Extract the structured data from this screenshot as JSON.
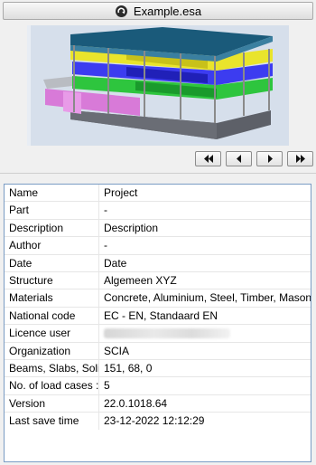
{
  "header": {
    "file_name": "Example.esa"
  },
  "preview": {
    "icon": "building-3d-model-image"
  },
  "navigation": {
    "first": "first-icon",
    "previous": "previous-icon",
    "next": "next-icon",
    "last": "last-icon"
  },
  "properties": {
    "rows": [
      {
        "name": "Name",
        "value": "Project"
      },
      {
        "name": "Part",
        "value": "-"
      },
      {
        "name": "Description",
        "value": "Description"
      },
      {
        "name": "Author",
        "value": "-"
      },
      {
        "name": "Date",
        "value": "Date"
      },
      {
        "name": "Structure",
        "value": "Algemeen XYZ"
      },
      {
        "name": "Materials",
        "value": "Concrete, Aluminium, Steel, Timber, Masonry, F"
      },
      {
        "name": "National code",
        "value": "EC - EN, Standaard EN"
      },
      {
        "name": "Licence user",
        "value": ""
      },
      {
        "name": "Organization",
        "value": "SCIA"
      },
      {
        "name": "Beams, Slabs, Solids",
        "value": "151, 68, 0"
      },
      {
        "name": "No. of load cases :",
        "value": "5"
      },
      {
        "name": "Version",
        "value": "22.0.1018.64"
      },
      {
        "name": "Last save time",
        "value": "23-12-2022 12:12:29"
      }
    ]
  }
}
